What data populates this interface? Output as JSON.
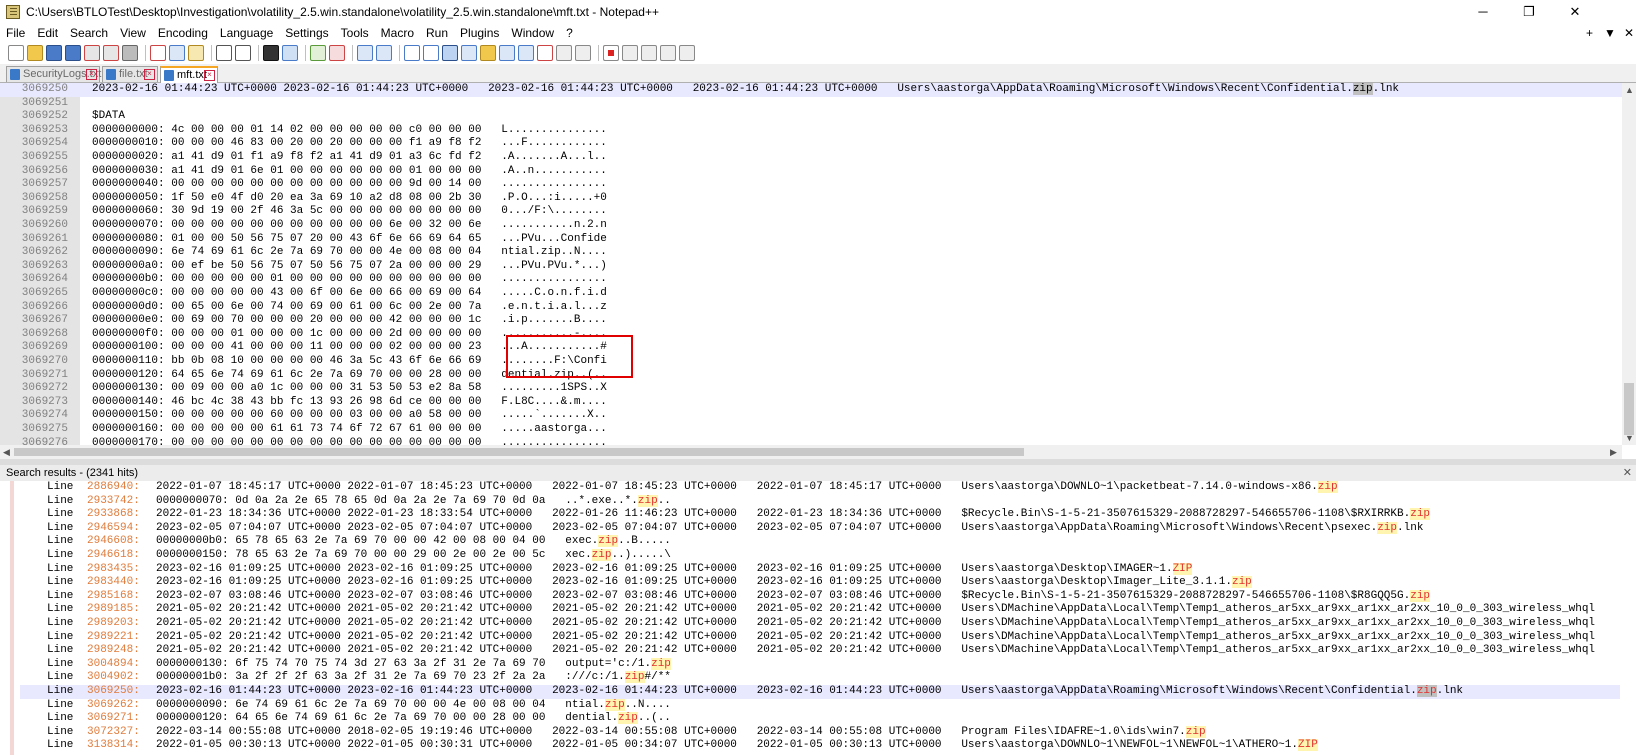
{
  "window": {
    "title": "C:\\Users\\BTLOTest\\Desktop\\Investigation\\volatility_2.5.win.standalone\\volatility_2.5.win.standalone\\mft.txt - Notepad++",
    "minimize": "─",
    "restore": "❐",
    "close": "✕"
  },
  "menu": {
    "items": [
      "File",
      "Edit",
      "Search",
      "View",
      "Encoding",
      "Language",
      "Settings",
      "Tools",
      "Macro",
      "Run",
      "Plugins",
      "Window",
      "?"
    ],
    "right": [
      "+",
      "▼",
      "✕"
    ]
  },
  "tabs": [
    {
      "label": "SecurityLogs.txt",
      "active": false
    },
    {
      "label": "file.txt",
      "active": false
    },
    {
      "label": "mft.txt",
      "active": true
    }
  ],
  "editor": {
    "current_line": "3069250",
    "lines": [
      {
        "num": "3069250",
        "text": "2023-02-16 01:44:23 UTC+0000 2023-02-16 01:44:23 UTC+0000   2023-02-16 01:44:23 UTC+0000   2023-02-16 01:44:23 UTC+0000   Users\\aastorga\\AppData\\Roaming\\Microsoft\\Windows\\Recent\\Confidential.",
        "match": "zip",
        "after": ".lnk"
      },
      {
        "num": "3069251",
        "text": ""
      },
      {
        "num": "3069252",
        "text": "$DATA"
      },
      {
        "num": "3069253",
        "text": "0000000000: 4c 00 00 00 01 14 02 00 00 00 00 00 c0 00 00 00   L..............."
      },
      {
        "num": "3069254",
        "text": "0000000010: 00 00 00 46 83 00 20 00 20 00 00 00 f1 a9 f8 f2   ...F............"
      },
      {
        "num": "3069255",
        "text": "0000000020: a1 41 d9 01 f1 a9 f8 f2 a1 41 d9 01 a3 6c fd f2   .A.......A...l.."
      },
      {
        "num": "3069256",
        "text": "0000000030: a1 41 d9 01 6e 01 00 00 00 00 00 00 01 00 00 00   .A..n..........."
      },
      {
        "num": "3069257",
        "text": "0000000040: 00 00 00 00 00 00 00 00 00 00 00 00 9d 00 14 00   ................"
      },
      {
        "num": "3069258",
        "text": "0000000050: 1f 50 e0 4f d0 20 ea 3a 69 10 a2 d8 08 00 2b 30   .P.O...:i.....+0"
      },
      {
        "num": "3069259",
        "text": "0000000060: 30 9d 19 00 2f 46 3a 5c 00 00 00 00 00 00 00 00   0.../F:\\........"
      },
      {
        "num": "3069260",
        "text": "0000000070: 00 00 00 00 00 00 00 00 00 00 00 6e 00 32 00 6e   ...........n.2.n"
      },
      {
        "num": "3069261",
        "text": "0000000080: 01 00 00 50 56 75 07 20 00 43 6f 6e 66 69 64 65   ...PVu...Confide"
      },
      {
        "num": "3069262",
        "text": "0000000090: 6e 74 69 61 6c 2e 7a 69 70 00 00 4e 00 08 00 04   ntial.zip..N...."
      },
      {
        "num": "3069263",
        "text": "00000000a0: 00 ef be 50 56 75 07 50 56 75 07 2a 00 00 00 29   ...PVu.PVu.*...)"
      },
      {
        "num": "3069264",
        "text": "00000000b0: 00 00 00 00 00 01 00 00 00 00 00 00 00 00 00 00   ................"
      },
      {
        "num": "3069265",
        "text": "00000000c0: 00 00 00 00 00 43 00 6f 00 6e 00 66 00 69 00 64   .....C.o.n.f.i.d"
      },
      {
        "num": "3069266",
        "text": "00000000d0: 00 65 00 6e 00 74 00 69 00 61 00 6c 00 2e 00 7a   .e.n.t.i.a.l...z"
      },
      {
        "num": "3069267",
        "text": "00000000e0: 00 69 00 70 00 00 00 20 00 00 00 42 00 00 00 1c   .i.p.......B...."
      },
      {
        "num": "3069268",
        "text": "00000000f0: 00 00 00 01 00 00 00 1c 00 00 00 2d 00 00 00 00   ...........-...."
      },
      {
        "num": "3069269",
        "text": "0000000100: 00 00 00 41 00 00 00 11 00 00 00 02 00 00 00 23   ...A...........#"
      },
      {
        "num": "3069270",
        "text": "0000000110: bb 0b 08 10 00 00 00 00 46 3a 5c 43 6f 6e 66 69   ........F:\\Confi"
      },
      {
        "num": "3069271",
        "text": "0000000120: 64 65 6e 74 69 61 6c 2e 7a 69 70 00 00 28 00 00   dential.zip..(.."
      },
      {
        "num": "3069272",
        "text": "0000000130: 00 09 00 00 a0 1c 00 00 00 31 53 50 53 e2 8a 58   .........1SPS..X"
      },
      {
        "num": "3069273",
        "text": "0000000140: 46 bc 4c 38 43 bb fc 13 93 26 98 6d ce 00 00 00   F.L8C....&.m...."
      },
      {
        "num": "3069274",
        "text": "0000000150: 00 00 00 00 00 60 00 00 00 03 00 00 a0 58 00 00   .....`.......X.."
      },
      {
        "num": "3069275",
        "text": "0000000160: 00 00 00 00 00 61 61 73 74 6f 72 67 61 00 00 00   .....aastorga..."
      },
      {
        "num": "3069276",
        "text": "0000000170: 00 00 00 00 00 00 00 00 00 00 00 00 00 00 00 00   ................"
      }
    ]
  },
  "search_results": {
    "header": "Search results - (2341 hits)",
    "close": "✕",
    "line_label": "Line",
    "rows": [
      {
        "num": "2886940:",
        "pre": "2022-01-07 18:45:17 UTC+0000 2022-01-07 18:45:23 UTC+0000   2022-01-07 18:45:23 UTC+0000   2022-01-07 18:45:17 UTC+0000   Users\\aastorga\\DOWNLO~1\\packetbeat-7.14.0-windows-x86.",
        "match": "zip",
        "post": ""
      },
      {
        "num": "2933742:",
        "pre": "0000000070: 0d 0a 2a 2e 65 78 65 0d 0a 2a 2e 7a 69 70 0d 0a   ..*.exe..*.",
        "match": "zip",
        "post": ".."
      },
      {
        "num": "2933868:",
        "pre": "2022-01-23 18:34:36 UTC+0000 2022-01-23 18:33:54 UTC+0000   2022-01-26 11:46:23 UTC+0000   2022-01-23 18:34:36 UTC+0000   $Recycle.Bin\\S-1-5-21-3507615329-2088728297-546655706-1108\\$RXIRRKB.",
        "match": "zip",
        "post": ""
      },
      {
        "num": "2946594:",
        "pre": "2023-02-05 07:04:07 UTC+0000 2023-02-05 07:04:07 UTC+0000   2023-02-05 07:04:07 UTC+0000   2023-02-05 07:04:07 UTC+0000   Users\\aastorga\\AppData\\Roaming\\Microsoft\\Windows\\Recent\\psexec.",
        "match": "zip",
        "post": ".lnk"
      },
      {
        "num": "2946608:",
        "pre": "00000000b0: 65 78 65 63 2e 7a 69 70 00 00 42 00 08 00 04 00   exec.",
        "match": "zip",
        "post": "..B....."
      },
      {
        "num": "2946618:",
        "pre": "0000000150: 78 65 63 2e 7a 69 70 00 00 29 00 2e 00 2e 00 5c   xec.",
        "match": "zip",
        "post": "..).....\\"
      },
      {
        "num": "2983435:",
        "pre": "2023-02-16 01:09:25 UTC+0000 2023-02-16 01:09:25 UTC+0000   2023-02-16 01:09:25 UTC+0000   2023-02-16 01:09:25 UTC+0000   Users\\aastorga\\Desktop\\IMAGER~1.",
        "match": "ZIP",
        "post": ""
      },
      {
        "num": "2983440:",
        "pre": "2023-02-16 01:09:25 UTC+0000 2023-02-16 01:09:25 UTC+0000   2023-02-16 01:09:25 UTC+0000   2023-02-16 01:09:25 UTC+0000   Users\\aastorga\\Desktop\\Imager_Lite_3.1.1.",
        "match": "zip",
        "post": ""
      },
      {
        "num": "2985168:",
        "pre": "2023-02-07 03:08:46 UTC+0000 2023-02-07 03:08:46 UTC+0000   2023-02-07 03:08:46 UTC+0000   2023-02-07 03:08:46 UTC+0000   $Recycle.Bin\\S-1-5-21-3507615329-2088728297-546655706-1108\\$R8GQQ5G.",
        "match": "zip",
        "post": ""
      },
      {
        "num": "2989185:",
        "pre": "2021-05-02 20:21:42 UTC+0000 2021-05-02 20:21:42 UTC+0000   2021-05-02 20:21:42 UTC+0000   2021-05-02 20:21:42 UTC+0000   Users\\DMachine\\AppData\\Local\\Temp\\Temp1_atheros_ar5xx_ar9xx_ar1xx_ar2xx_10_0_0_303_wireless_whql",
        "match": "",
        "post": ""
      },
      {
        "num": "2989203:",
        "pre": "2021-05-02 20:21:42 UTC+0000 2021-05-02 20:21:42 UTC+0000   2021-05-02 20:21:42 UTC+0000   2021-05-02 20:21:42 UTC+0000   Users\\DMachine\\AppData\\Local\\Temp\\Temp1_atheros_ar5xx_ar9xx_ar1xx_ar2xx_10_0_0_303_wireless_whql",
        "match": "",
        "post": ""
      },
      {
        "num": "2989221:",
        "pre": "2021-05-02 20:21:42 UTC+0000 2021-05-02 20:21:42 UTC+0000   2021-05-02 20:21:42 UTC+0000   2021-05-02 20:21:42 UTC+0000   Users\\DMachine\\AppData\\Local\\Temp\\Temp1_atheros_ar5xx_ar9xx_ar1xx_ar2xx_10_0_0_303_wireless_whql",
        "match": "",
        "post": ""
      },
      {
        "num": "2989248:",
        "pre": "2021-05-02 20:21:42 UTC+0000 2021-05-02 20:21:42 UTC+0000   2021-05-02 20:21:42 UTC+0000   2021-05-02 20:21:42 UTC+0000   Users\\DMachine\\AppData\\Local\\Temp\\Temp1_atheros_ar5xx_ar9xx_ar1xx_ar2xx_10_0_0_303_wireless_whql",
        "match": "",
        "post": ""
      },
      {
        "num": "3004894:",
        "pre": "0000000130: 6f 75 74 70 75 74 3d 27 63 3a 2f 31 2e 7a 69 70   output='c:/1.",
        "match": "zip",
        "post": ""
      },
      {
        "num": "3004902:",
        "pre": "00000001b0: 3a 2f 2f 2f 63 3a 2f 31 2e 7a 69 70 23 2f 2a 2a   :///c:/1.",
        "match": "zip",
        "post": "#/**"
      },
      {
        "num": "3069250:",
        "pre": "2023-02-16 01:44:23 UTC+0000 2023-02-16 01:44:23 UTC+0000   2023-02-16 01:44:23 UTC+0000   2023-02-16 01:44:23 UTC+0000   Users\\aastorga\\AppData\\Roaming\\Microsoft\\Windows\\Recent\\Confidential.",
        "match": "zip",
        "post": ".lnk",
        "current": true
      },
      {
        "num": "3069262:",
        "pre": "0000000090: 6e 74 69 61 6c 2e 7a 69 70 00 00 4e 00 08 00 04   ntial.",
        "match": "zip",
        "post": "..N...."
      },
      {
        "num": "3069271:",
        "pre": "0000000120: 64 65 6e 74 69 61 6c 2e 7a 69 70 00 00 28 00 00   dential.",
        "match": "zip",
        "post": "..(.."
      },
      {
        "num": "3072327:",
        "pre": "2022-03-14 00:55:08 UTC+0000 2018-02-05 19:19:46 UTC+0000   2022-03-14 00:55:08 UTC+0000   2022-03-14 00:55:08 UTC+0000   Program Files\\IDAFRE~1.0\\ids\\win7.",
        "match": "zip",
        "post": ""
      },
      {
        "num": "3138314:",
        "pre": "2022-01-05 00:30:13 UTC+0000 2022-01-05 00:30:31 UTC+0000   2022-01-05 00:34:07 UTC+0000   2022-01-05 00:30:13 UTC+0000   Users\\aastorga\\DOWNLO~1\\NEWFOL~1\\NEWFOL~1\\ATHERO~1.",
        "match": "ZIP",
        "post": ""
      }
    ]
  },
  "colors": {
    "accent": "#e00000",
    "match": "#e03030",
    "line_number": "#e07b3a",
    "current_line": "#e8e8ff"
  },
  "icons": [
    "new-file-icon",
    "open-icon",
    "save-icon",
    "save-all-icon",
    "close-icon",
    "close-all-icon",
    "print-icon",
    "cut-icon",
    "copy-icon",
    "paste-icon",
    "undo-icon",
    "redo-icon",
    "find-icon",
    "replace-icon",
    "zoom-in-icon",
    "zoom-out-icon",
    "sync-v-icon",
    "sync-h-icon",
    "word-wrap-icon",
    "show-all-icon",
    "indent-guide-icon",
    "udl-icon",
    "doc-map-icon",
    "function-list-icon",
    "folder-as-workspace-icon",
    "monitoring-icon",
    "record-macro-icon",
    "stop-record-icon",
    "play-macro-icon",
    "play-multiple-icon",
    "save-macro-icon"
  ]
}
